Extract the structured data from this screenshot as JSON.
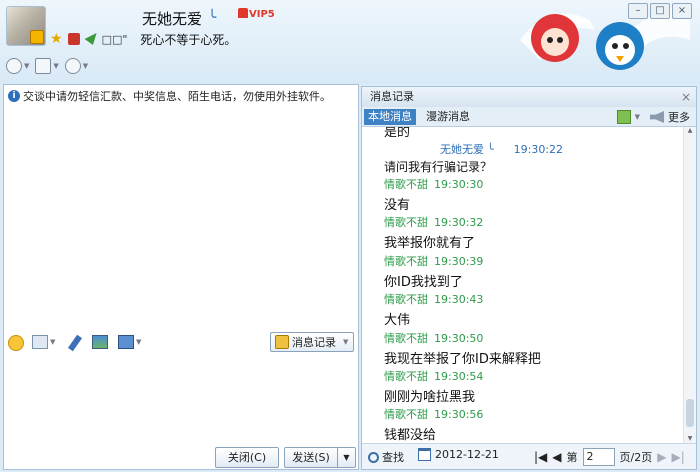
{
  "header": {
    "nickname": "无她无爱",
    "wave": "╰",
    "vip": "VIP5",
    "status_icons_text": "□□\"",
    "signature": "死心不等于心死。",
    "window_controls": [
      "–",
      "□",
      "×"
    ]
  },
  "chat": {
    "notice": "交谈中请勿轻信汇款、中奖信息、陌生电话，勿使用外挂软件。",
    "history_button": "消息记录",
    "close_button": "关闭(C)",
    "send_button": "发送(S)"
  },
  "history": {
    "title": "消息记录",
    "tabs": [
      "本地消息",
      "漫游消息"
    ],
    "more": "更多",
    "cut_text": "是的",
    "messages": [
      {
        "sender": "无她无爱",
        "time": "19:30:22",
        "text": "请问我有行骗记录？",
        "side": "me"
      },
      {
        "sender": "情歌不甜",
        "time": "19:30:30",
        "text": "没有"
      },
      {
        "sender": "情歌不甜",
        "time": "19:30:32",
        "text": "我举报你就有了"
      },
      {
        "sender": "情歌不甜",
        "time": "19:30:39",
        "text": "你ID我找到了"
      },
      {
        "sender": "情歌不甜",
        "time": "19:30:43",
        "text": "大伟"
      },
      {
        "sender": "情歌不甜",
        "time": "19:30:50",
        "text": "我现在举报了你ID来解释把"
      },
      {
        "sender": "情歌不甜",
        "time": "19:30:54",
        "text": "刚刚为啥拉黑我"
      },
      {
        "sender": "情歌不甜",
        "time": "19:30:56",
        "text": "钱都没给"
      }
    ],
    "find": "查找",
    "date": "2012-12-21",
    "page_prefix": "第",
    "page_value": "2",
    "page_suffix": "页/2页"
  }
}
